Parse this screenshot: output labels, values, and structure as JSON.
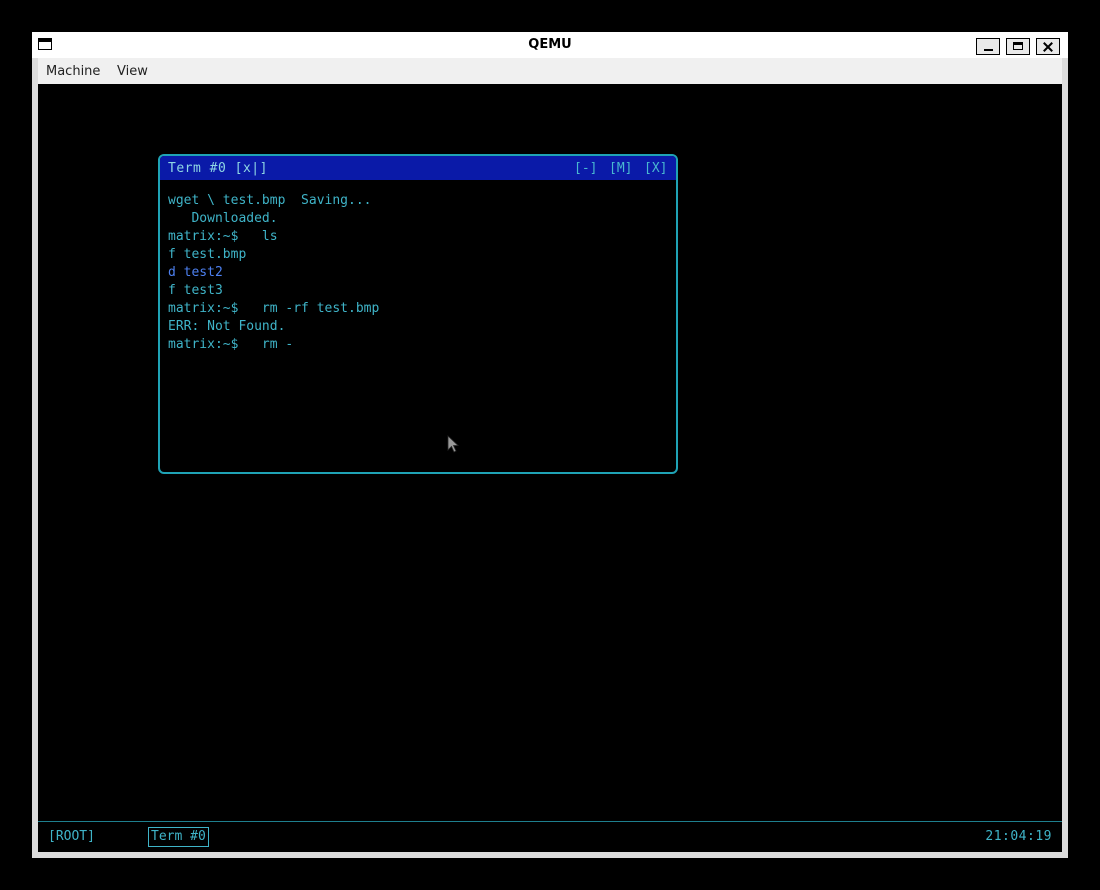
{
  "host_window": {
    "title": "QEMU",
    "menu": [
      "Machine",
      "View"
    ]
  },
  "terminal": {
    "title": "Term #0 [x|]",
    "controls": [
      "[-]",
      "[M]",
      "[X]"
    ],
    "lines": [
      {
        "prefix": "",
        "text": "wget \\ test.bmp  Saving..."
      },
      {
        "prefix": "",
        "text": "   Downloaded."
      },
      {
        "prefix": "",
        "text": "matrix:~$   ls"
      },
      {
        "prefix": "",
        "text": "f test.bmp"
      },
      {
        "prefix": "d ",
        "text": "test2"
      },
      {
        "prefix": "",
        "text": "f test3"
      },
      {
        "prefix": "",
        "text": "matrix:~$   rm -rf test.bmp"
      },
      {
        "prefix": "",
        "text": "ERR: Not Found."
      },
      {
        "prefix": "",
        "text": "matrix:~$   rm -"
      }
    ]
  },
  "taskbar": {
    "root_label": "[ROOT]",
    "term_label": "Term #0",
    "clock": "21:04:19"
  },
  "colors": {
    "terminal_text": "#3fb4c8",
    "terminal_border": "#1fa3b5",
    "terminal_titlebar": "#0a1aa8",
    "directory_entry": "#4d80f0"
  }
}
